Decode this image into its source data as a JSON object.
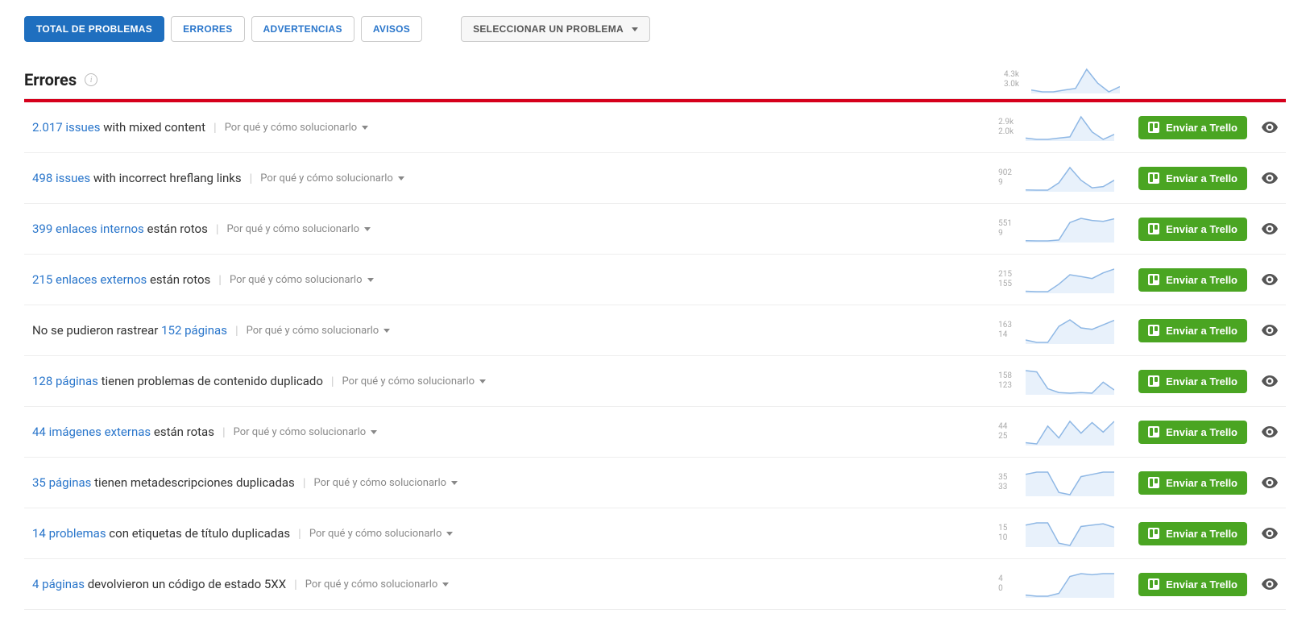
{
  "tabs": {
    "total": "TOTAL DE PROBLEMAS",
    "errors": "ERRORES",
    "warnings": "ADVERTENCIAS",
    "notices": "AVISOS"
  },
  "dropdown_label": "SELECCIONAR UN PROBLEMA",
  "section_title": "Errores",
  "why_label": "Por qué y cómo solucionarlo",
  "trello_label": "Enviar a Trello",
  "header_spark": {
    "high": "4.3k",
    "low": "3.0k",
    "series": [
      3.1,
      3.0,
      3.0,
      3.1,
      3.2,
      4.3,
      3.5,
      3.0,
      3.3
    ]
  },
  "issues": [
    {
      "link": "2.017 issues",
      "rest": " with mixed content",
      "prefix": "",
      "high": "2.9k",
      "low": "2.0k",
      "series": [
        2.05,
        2.0,
        2.0,
        2.05,
        2.1,
        2.9,
        2.3,
        2.0,
        2.2
      ]
    },
    {
      "link": "498 issues",
      "rest": " with incorrect hreflang links",
      "prefix": "",
      "high": "902",
      "low": "9",
      "series": [
        20,
        9,
        9,
        300,
        902,
        400,
        100,
        150,
        400
      ]
    },
    {
      "link": "399 enlaces internos",
      "rest": " están rotos",
      "prefix": "",
      "high": "551",
      "low": "9",
      "series": [
        15,
        9,
        9,
        30,
        450,
        551,
        500,
        480,
        540
      ]
    },
    {
      "link": "215 enlaces externos",
      "rest": " están rotos",
      "prefix": "",
      "high": "215",
      "low": "155",
      "series": [
        156,
        155,
        155,
        175,
        200,
        195,
        190,
        205,
        215
      ]
    },
    {
      "link": "152 páginas",
      "rest": "",
      "prefix": "No se pudieron rastrear ",
      "high": "163",
      "low": "14",
      "series": [
        30,
        14,
        14,
        120,
        163,
        110,
        100,
        130,
        160
      ]
    },
    {
      "link": "128 páginas",
      "rest": " tienen problemas de contenido duplicado",
      "prefix": "",
      "high": "158",
      "low": "123",
      "series": [
        158,
        156,
        130,
        124,
        123,
        124,
        123,
        140,
        128
      ]
    },
    {
      "link": "44 imágenes externas",
      "rest": " están rotas",
      "prefix": "",
      "high": "44",
      "low": "25",
      "series": [
        26,
        25,
        40,
        30,
        44,
        34,
        43,
        35,
        44
      ]
    },
    {
      "link": "35 páginas",
      "rest": " tienen metadescripciones duplicadas",
      "prefix": "",
      "high": "35",
      "low": "33",
      "series": [
        34.8,
        35,
        35,
        33.2,
        33,
        34.6,
        34.8,
        35,
        35
      ]
    },
    {
      "link": "14 problemas",
      "rest": " con etiquetas de título duplicadas",
      "prefix": "",
      "high": "15",
      "low": "10",
      "series": [
        14.5,
        15,
        15,
        10.5,
        10,
        14.2,
        14.5,
        14.8,
        14
      ]
    },
    {
      "link": "4 páginas",
      "rest": " devolvieron un código de estado 5XX",
      "prefix": "",
      "high": "4",
      "low": "0",
      "series": [
        0.2,
        0,
        0,
        0.5,
        3.5,
        4,
        3.8,
        4,
        4
      ]
    }
  ]
}
